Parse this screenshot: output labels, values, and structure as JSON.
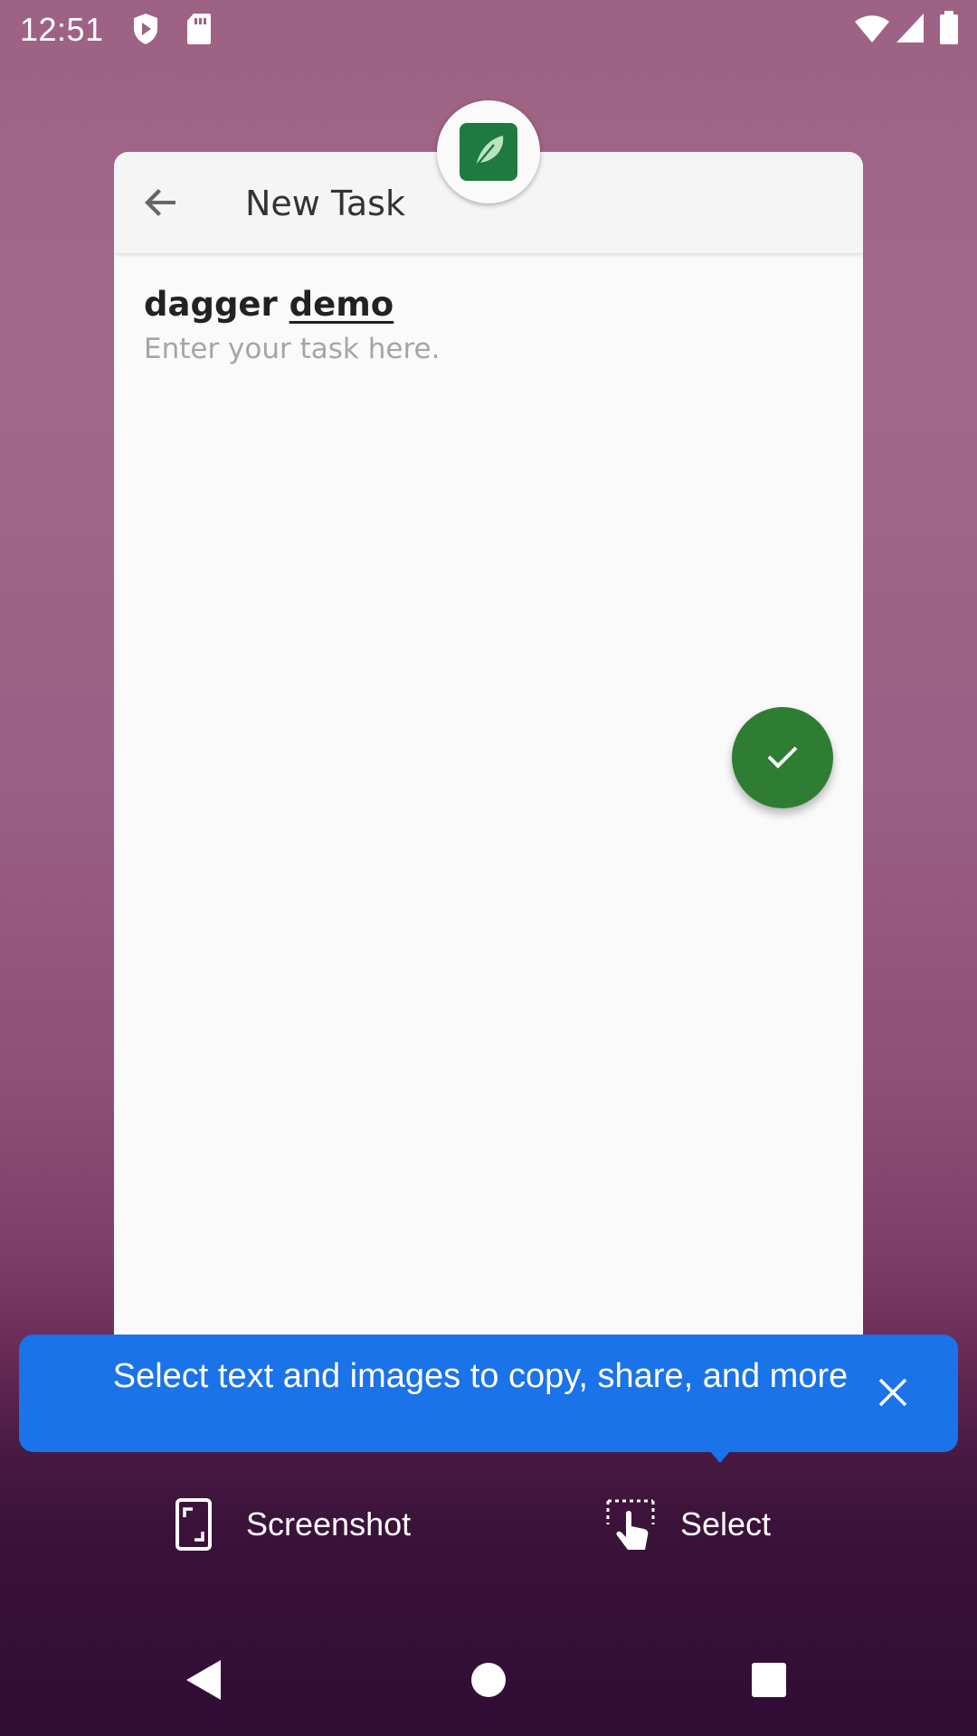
{
  "status_bar": {
    "time": "12:51",
    "icons": [
      "shield-icon",
      "sd-card-icon",
      "wifi-icon",
      "signal-icon",
      "battery-icon"
    ]
  },
  "app": {
    "title": "New Task",
    "back_icon": "arrow-back-icon",
    "icon": "leaf-app-icon"
  },
  "task": {
    "title_plain": "dagger",
    "title_underlined": "demo",
    "placeholder": "Enter your task here.",
    "value": ""
  },
  "fab": {
    "icon": "check-icon",
    "color": "#2e7d32"
  },
  "tooltip": {
    "text": "Select text and images to copy, share, and more",
    "color": "#1a73e8",
    "close_icon": "close-icon"
  },
  "actions": {
    "screenshot_label": "Screenshot",
    "select_label": "Select"
  },
  "nav": [
    "back-icon",
    "home-icon",
    "recents-icon"
  ]
}
